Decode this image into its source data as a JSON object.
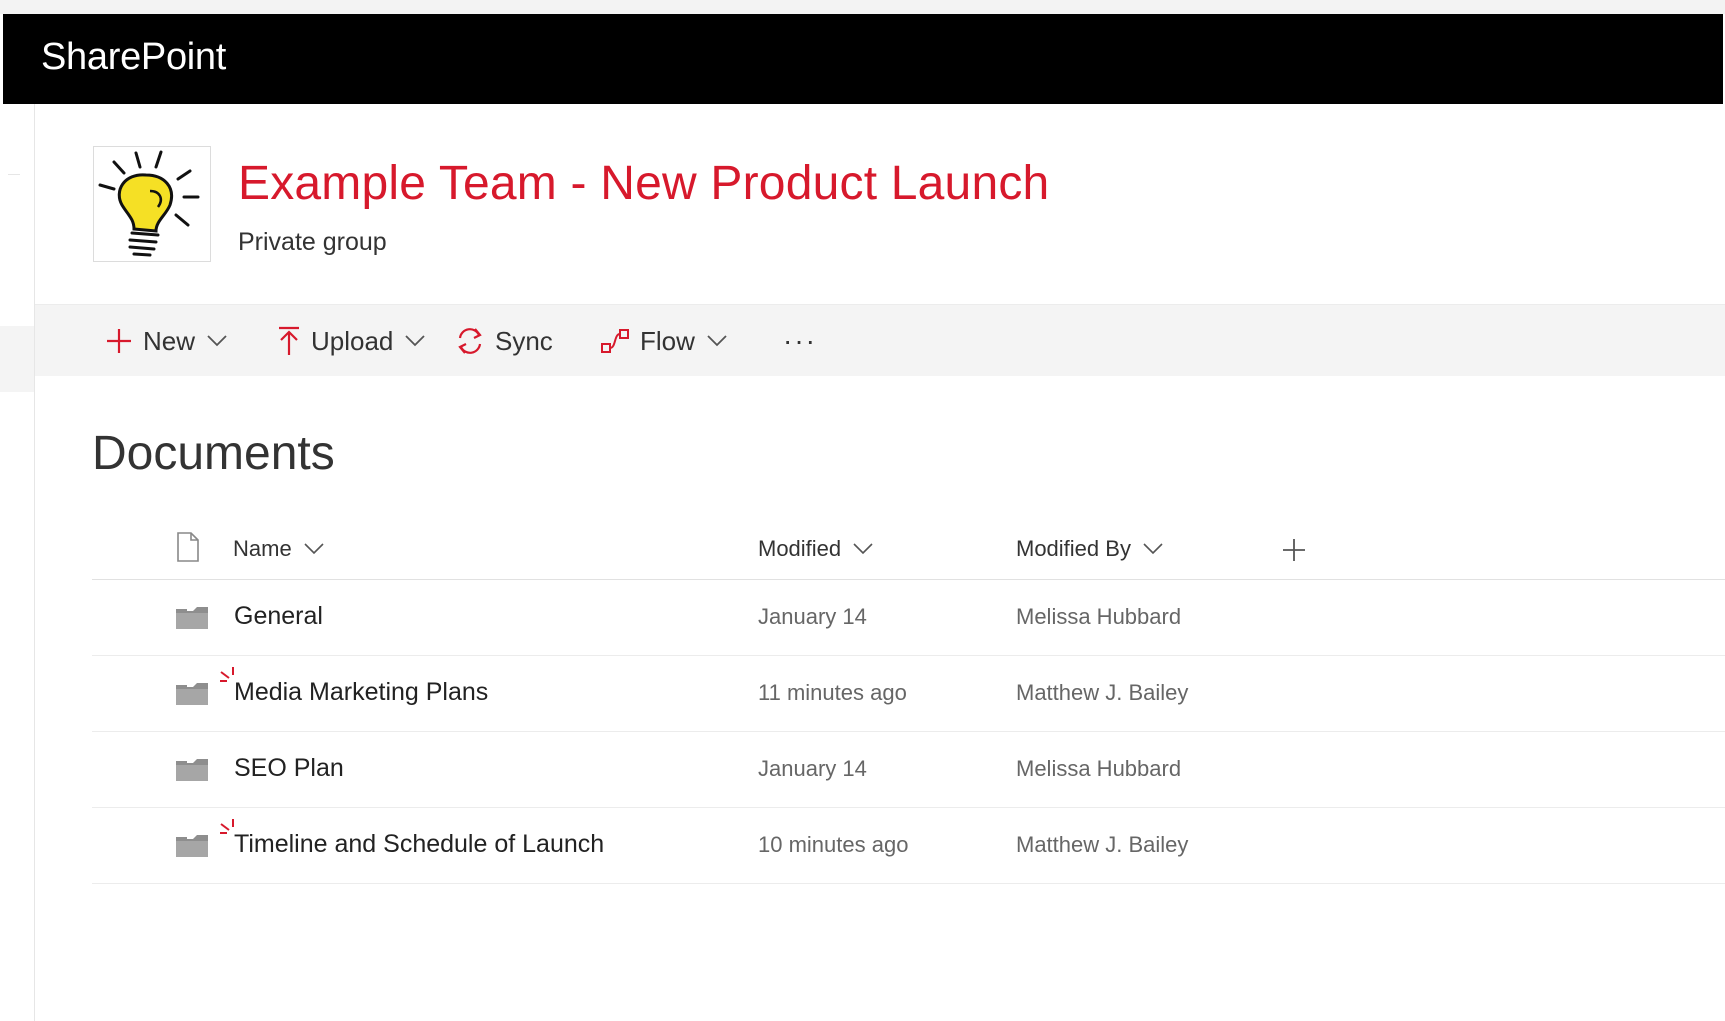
{
  "suite_bar": {
    "brand": "SharePoint"
  },
  "site": {
    "title": "Example Team - New Product Launch",
    "subtitle": "Private group",
    "logo_icon": "lightbulb-icon"
  },
  "command_bar": {
    "new_label": "New",
    "upload_label": "Upload",
    "sync_label": "Sync",
    "flow_label": "Flow",
    "more_label": "···"
  },
  "library": {
    "title": "Documents",
    "columns": {
      "name": "Name",
      "modified": "Modified",
      "modified_by": "Modified By"
    },
    "rows": [
      {
        "name": "General",
        "modified": "January 14",
        "modified_by": "Melissa Hubbard",
        "is_new": false
      },
      {
        "name": "Media Marketing Plans",
        "modified": "11 minutes ago",
        "modified_by": "Matthew J. Bailey",
        "is_new": true
      },
      {
        "name": "SEO Plan",
        "modified": "January 14",
        "modified_by": "Melissa Hubbard",
        "is_new": false
      },
      {
        "name": "Timeline and Schedule of Launch",
        "modified": "10 minutes ago",
        "modified_by": "Matthew J. Bailey",
        "is_new": true
      }
    ]
  },
  "colors": {
    "accent": "#d7192c",
    "suite_bar": "#000000",
    "command_bar": "#f4f4f4"
  }
}
